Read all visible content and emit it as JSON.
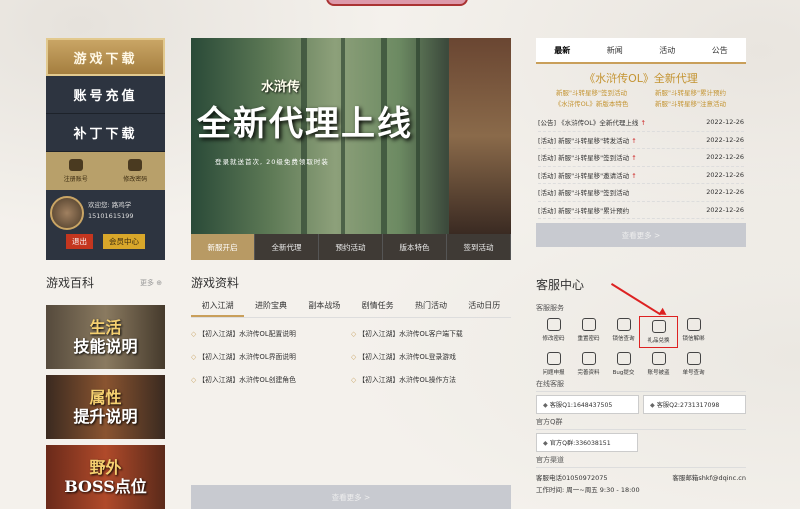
{
  "nav": {
    "download": "游戏下载",
    "recharge": "账号充值",
    "patch": "补丁下载",
    "register": "注册账号",
    "change_password": "修改密码",
    "welcome": "欢迎您: 路鸡学",
    "phone": "15101615199",
    "logout": "退出",
    "member": "会员中心"
  },
  "banner": {
    "logo": "水浒传",
    "title": "全新代理上线",
    "subtitle": "登录就送首次, 20级免费领取时装",
    "tabs": [
      "新服开启",
      "全新代理",
      "预约活动",
      "版本特色",
      "签到活动"
    ]
  },
  "news": {
    "tabs": [
      "最新",
      "新闻",
      "活动",
      "公告"
    ],
    "headline": "《水浒传OL》全新代理",
    "links": [
      "新服\"斗转星移\"签到活动",
      "新服\"斗转星移\"累计预约",
      "《水浒传OL》新版本特色",
      "新服\"斗转星移\"注意活动"
    ],
    "items": [
      {
        "title": "[公告] 《水浒传OL》全新代理上线",
        "new": "↑",
        "date": "2022-12-26"
      },
      {
        "title": "[活动] 新服\"斗转星移\"转发活动",
        "new": "↑",
        "date": "2022-12-26"
      },
      {
        "title": "[活动] 新服\"斗转星移\"签到活动",
        "new": "↑",
        "date": "2022-12-26"
      },
      {
        "title": "[活动] 新服\"斗转星移\"邀请活动",
        "new": "↑",
        "date": "2022-12-26"
      },
      {
        "title": "[活动] 新服\"斗转星移\"签到活动",
        "new": "",
        "date": "2022-12-26"
      },
      {
        "title": "[活动] 新服\"斗转星移\"累计预约",
        "new": "",
        "date": "2022-12-26"
      }
    ],
    "more": "查看更多 >"
  },
  "wiki": {
    "title": "游戏百科",
    "more": "更多 ⊕",
    "cards": [
      {
        "line1": "生活",
        "line2": "技能说明"
      },
      {
        "line1": "属性",
        "line2": "提升说明"
      },
      {
        "line1": "野外",
        "line2": "BOSS点位"
      }
    ]
  },
  "info": {
    "title": "游戏资料",
    "tabs": [
      "初入江湖",
      "进阶宝典",
      "副本战场",
      "剧情任务",
      "热门活动",
      "活动日历"
    ],
    "items": [
      "【初入江湖】水浒传OL配置说明",
      "【初入江湖】水浒传OL客户端下载",
      "【初入江湖】水浒传OL界面说明",
      "【初入江湖】水浒传OL登录游戏",
      "【初入江湖】水浒传OL创建角色",
      "【初入江湖】水浒传OL操作方法"
    ],
    "more": "查看更多 >"
  },
  "service": {
    "title": "客服中心",
    "label": "客服服务",
    "items": [
      "修改密码",
      "重置密码",
      "锁信查询",
      "礼品兑换",
      "锁信解绑",
      "问题申报",
      "完善资料",
      "Bug提交",
      "账号被盗",
      "单号查询"
    ],
    "online_label": "在线客服",
    "qq1": "客服Q1:1648437505",
    "qq2": "客服Q2:2731317098",
    "group_label": "官方Q群",
    "group": "官方Q群:336038151",
    "channel_label": "官方渠道",
    "phone": "客服电话01050972075",
    "email": "客服邮箱shkf@dqinc.cn",
    "hours": "工作时间: 周一~周五 9:30 - 18:00"
  }
}
